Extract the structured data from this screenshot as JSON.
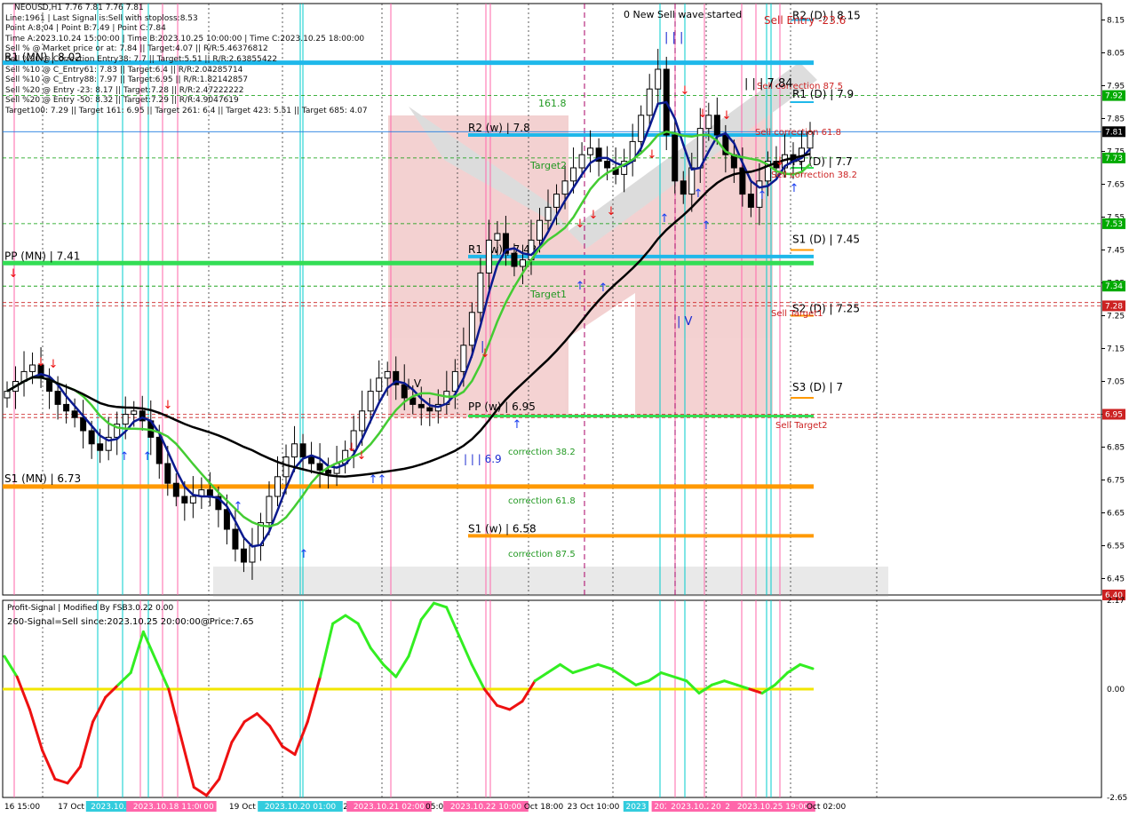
{
  "header": {
    "symbol_line": "NEOUSD,H1  7.76 7.81 7.76 7.81",
    "info_lines": [
      "Line:1961 | Last Signal is:Sell with stoploss:8.53",
      "Point A:8.04 | Point B:7.49 | Point C:7.84",
      "Time A:2023.10.24 15:00:00 | Time B:2023.10.25 10:00:00 | Time C:2023.10.25 18:00:00",
      "Sell % @ Market price or at: 7.84 || Target:4.07 || R/R:5.46376812",
      "Sell %20 @ Correction Entry38: 7.7 || Target:5.51 || R/R:2.63855422",
      "Sell %10 @ C_Entry61: 7.83 || Target:6.4 || R/R:2.04285714",
      "Sell %10 @ C_Entry88: 7.97 || Target:6.95 || R/R:1.82142857",
      "Sell %20 @ Entry -23: 8.17 || Target:7.28 || R/R:2.47222222",
      "Sell %20 @ Entry -50: 8.32 || Target:7.29 || R/R:4.9047619",
      "Target100: 7.29 || Target 161: 6.95 || Target 261: 6.4 || Target 423: 5.51 || Target 685: 4.07"
    ]
  },
  "chart_data": [
    {
      "type": "candlestick",
      "title": "NEOUSD,H1",
      "ylim": [
        6.4,
        8.2
      ],
      "y_ticks": [
        "8.15",
        "8.05",
        "7.95",
        "7.85",
        "7.75",
        "7.65",
        "7.55",
        "7.45",
        "7.35",
        "7.25",
        "7.15",
        "7.05",
        "6.95",
        "6.85",
        "6.75",
        "6.65",
        "6.55",
        "6.45"
      ],
      "price_badges": [
        {
          "value": "7.92",
          "color": "#00aa00"
        },
        {
          "value": "7.81",
          "color": "#000000"
        },
        {
          "value": "7.73",
          "color": "#00aa00"
        },
        {
          "value": "7.53",
          "color": "#00aa00"
        },
        {
          "value": "7.34",
          "color": "#00aa00"
        },
        {
          "value": "7.28",
          "color": "#cc2222"
        },
        {
          "value": "6.95",
          "color": "#cc2222"
        },
        {
          "value": "6.40",
          "color": "#cc2222"
        }
      ],
      "levels": [
        {
          "label": "R1 (MN) | 8.02",
          "price": 8.02,
          "color": "#1fb8ea"
        },
        {
          "label": "R2 (w) | 7.8",
          "price": 7.8,
          "color": "#1fb8ea"
        },
        {
          "label": "R1 (w) | 7.43",
          "price": 7.43,
          "color": "#1fb8ea"
        },
        {
          "label": "PP (MN) | 7.41",
          "price": 7.41,
          "color": "#33dd55"
        },
        {
          "label": "S1 (MN) | 6.73",
          "price": 6.73,
          "color": "#ff9900"
        },
        {
          "label": "S1 (w) | 6.58",
          "price": 6.58,
          "color": "#ff9900"
        },
        {
          "label": "R2 (D) | 8.15",
          "price": 8.15,
          "color": "#1fb8ea"
        },
        {
          "label": "R1 (D) | 7.9",
          "price": 7.9,
          "color": "#1fb8ea"
        },
        {
          "label": "PP (D) | 7.7",
          "price": 7.7,
          "color": "#33dd55"
        },
        {
          "label": "S1 (D) | 7.45",
          "price": 7.45,
          "color": "#ff9900"
        },
        {
          "label": "S2 (D) | 7.25",
          "price": 7.25,
          "color": "#ff9900"
        },
        {
          "label": "S3 (D) | 7",
          "price": 7.0,
          "color": "#ff9900"
        }
      ],
      "annotations": {
        "wave_started": "0 New Sell wave started",
        "sell_entry": "Sell Entry -23.6",
        "sell_correction_875": "Sell correction 87.5",
        "sell_correction_618": "Sell correction 61.8",
        "sell_correction_382": "Sell correction 38.2",
        "sell_target1": "Sell Target1",
        "sell_target2": "Sell Target2",
        "lbl_161": "161.8",
        "target2": "Target2",
        "target1": "Target1",
        "corr_382": "correction 38.2",
        "corr_618": "correction 61.8",
        "corr_875": "correction 87.5",
        "wave_iii_top": "| | |",
        "wave_784": "| | | 7.84",
        "wave_iv_left": "| V",
        "wave_iv_right": "| V",
        "wave_i": "|",
        "wave_iii_69": "| | | 6.9",
        "pp_w": "PP (w) | 6.95"
      },
      "x_labels": [
        "16 15:00",
        "17 Oct",
        "2023.10.1",
        "2023.10.18 11:00",
        "00",
        "19 Oct 05",
        "2023.10.20 01:00",
        "20",
        "2023.10.21 02:00",
        "05:00",
        "2023.10.22 10:00",
        "Oct 18:00",
        "23 Oct 10:00",
        "2023",
        "202",
        "2023.10.2",
        "20",
        "20",
        "2023.10.25 19:00",
        "Oct 02:00"
      ],
      "series": [
        {
          "name": "close",
          "values": [
            7.02,
            7.05,
            7.08,
            7.1,
            7.06,
            7.02,
            6.98,
            6.96,
            6.94,
            6.9,
            6.86,
            6.84,
            6.88,
            6.92,
            6.95,
            6.96,
            6.93,
            6.88,
            6.8,
            6.74,
            6.7,
            6.68,
            6.7,
            6.72,
            6.7,
            6.66,
            6.6,
            6.54,
            6.5,
            6.55,
            6.62,
            6.7,
            6.76,
            6.82,
            6.86,
            6.82,
            6.8,
            6.78,
            6.77,
            6.8,
            6.84,
            6.9,
            6.96,
            7.02,
            7.06,
            7.08,
            7.04,
            7.0,
            6.98,
            6.97,
            6.96,
            6.98,
            7.02,
            7.08,
            7.16,
            7.26,
            7.38,
            7.48,
            7.5,
            7.44,
            7.4,
            7.42,
            7.48,
            7.54,
            7.58,
            7.62,
            7.66,
            7.7,
            7.74,
            7.76,
            7.72,
            7.7,
            7.68,
            7.72,
            7.78,
            7.86,
            7.94,
            8.0,
            7.8,
            7.66,
            7.62,
            7.7,
            7.82,
            7.86,
            7.8,
            7.74,
            7.7,
            7.62,
            7.58,
            7.66,
            7.72,
            7.7,
            7.74,
            7.72,
            7.76,
            7.81
          ]
        }
      ]
    },
    {
      "type": "line",
      "title": "Profit-Signal | Modified By FSB3.0.22 0.00",
      "subtitle": "260-Signal=Sell since:2023.10.25 20:00:00@Price:7.65",
      "ylim": [
        -2.65,
        2.17
      ],
      "y_ticks": [
        "2.17",
        "0.00",
        "-2.65"
      ],
      "series": [
        {
          "name": "oscillator",
          "values": [
            0.8,
            0.3,
            -0.5,
            -1.5,
            -2.2,
            -2.3,
            -1.9,
            -0.8,
            -0.2,
            0.1,
            0.4,
            1.4,
            0.7,
            0.0,
            -1.2,
            -2.4,
            -2.6,
            -2.2,
            -1.3,
            -0.8,
            -0.6,
            -0.9,
            -1.4,
            -1.6,
            -0.8,
            0.3,
            1.6,
            1.8,
            1.6,
            1.0,
            0.6,
            0.3,
            0.8,
            1.7,
            2.1,
            2.0,
            1.3,
            0.6,
            0.0,
            -0.4,
            -0.5,
            -0.3,
            0.2,
            0.4,
            0.6,
            0.4,
            0.5,
            0.6,
            0.5,
            0.3,
            0.1,
            0.2,
            0.4,
            0.3,
            0.2,
            -0.1,
            0.1,
            0.2,
            0.1,
            0.0,
            -0.1,
            0.1,
            0.4,
            0.6,
            0.5
          ]
        }
      ]
    }
  ]
}
